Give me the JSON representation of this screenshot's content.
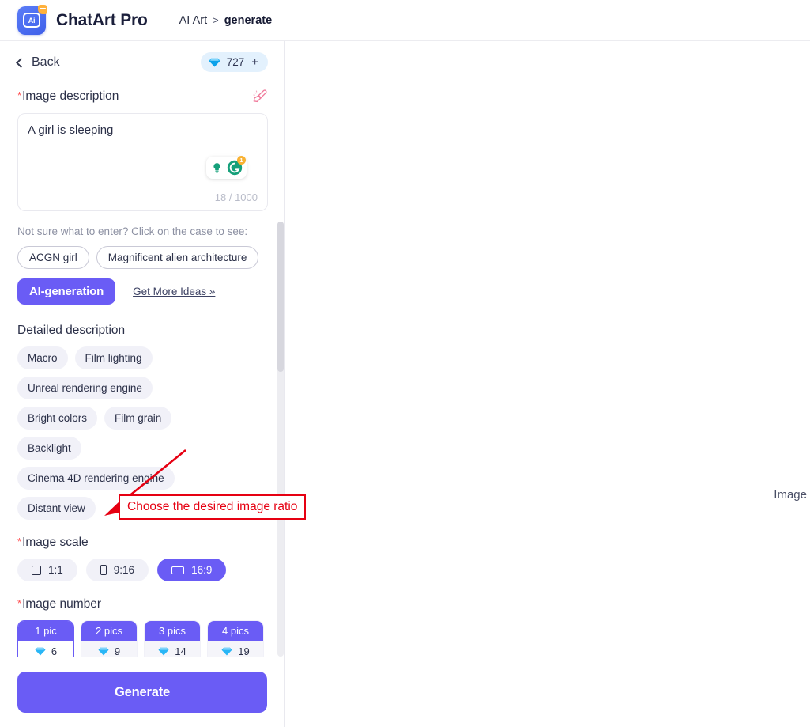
{
  "header": {
    "brand": "ChatArt Pro",
    "logo_text": "Ai",
    "breadcrumb": {
      "root": "AI Art",
      "separator": ">",
      "current": "generate"
    }
  },
  "sidebar": {
    "back_label": "Back",
    "credits": {
      "value": "727",
      "plus": "+",
      "icon": "gem-icon"
    },
    "image_description": {
      "label": "Image description",
      "required": true,
      "clear_icon": "brush-icon",
      "value": "A girl is sleeping",
      "counter": "18 / 1000",
      "grammarly": {
        "badge": "1",
        "bulb_icon": "lightbulb-icon",
        "g_icon": "grammarly-icon"
      }
    },
    "hint": "Not sure what to enter? Click on the case to see:",
    "case_chips": [
      "ACGN girl",
      "Magnificent alien architecture"
    ],
    "ai_generation_label": "AI-generation",
    "more_ideas_label": "Get More Ideas »",
    "detailed_description": {
      "title": "Detailed description",
      "tags": [
        "Macro",
        "Film lighting",
        "Unreal rendering engine",
        "Bright colors",
        "Film grain",
        "Backlight",
        "Cinema 4D rendering engine",
        "Distant view"
      ]
    },
    "image_scale": {
      "label": "Image scale",
      "required": true,
      "options": [
        {
          "label": "1:1",
          "icon": "square-icon",
          "selected": false
        },
        {
          "label": "9:16",
          "icon": "portrait-icon",
          "selected": false
        },
        {
          "label": "16:9",
          "icon": "landscape-icon",
          "selected": true
        }
      ]
    },
    "image_number": {
      "label": "Image number",
      "required": true,
      "options": [
        {
          "label": "1 pic",
          "cost": "6",
          "selected": true
        },
        {
          "label": "2 pics",
          "cost": "9",
          "selected": false
        },
        {
          "label": "3 pics",
          "cost": "14",
          "selected": false
        },
        {
          "label": "4 pics",
          "cost": "19",
          "selected": false
        }
      ]
    },
    "generate_label": "Generate"
  },
  "main_panel": {
    "label": "Image"
  },
  "annotation": {
    "text": "Choose the desired image ratio",
    "color": "#e60012"
  },
  "colors": {
    "accent": "#6a5cf5",
    "chip_bg": "#f1f1f8",
    "credits_bg": "#e3f1fd",
    "annotation": "#e60012"
  }
}
